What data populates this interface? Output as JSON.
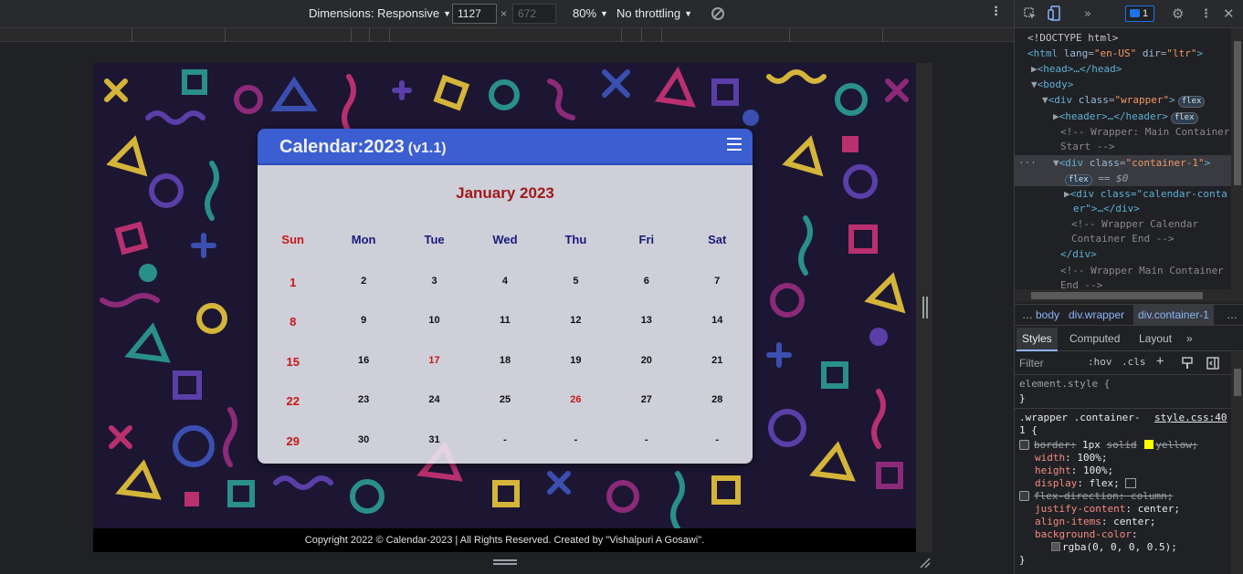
{
  "device_toolbar": {
    "dimensions_label": "Dimensions: Responsive",
    "width_value": "1127",
    "height_placeholder": "672",
    "times": "×",
    "zoom": "80%",
    "throttling": "No throttling"
  },
  "calendar": {
    "app_title": "Calendar:2023",
    "version": "(v1.1)",
    "month": "January 2023",
    "weekdays": [
      "Sun",
      "Mon",
      "Tue",
      "Wed",
      "Thu",
      "Fri",
      "Sat"
    ],
    "weeks": [
      [
        "1",
        "2",
        "3",
        "4",
        "5",
        "6",
        "7"
      ],
      [
        "8",
        "9",
        "10",
        "11",
        "12",
        "13",
        "14"
      ],
      [
        "15",
        "16",
        "17",
        "18",
        "19",
        "20",
        "21"
      ],
      [
        "22",
        "23",
        "24",
        "25",
        "26",
        "27",
        "28"
      ],
      [
        "29",
        "30",
        "31",
        "-",
        "-",
        "-",
        "-"
      ]
    ],
    "highlight_color": "#c81818"
  },
  "site_footer": {
    "text": "Copyright 2022 © Calendar-2023 | All Rights Reserved. Created by \"Vishalpuri A Gosawi\"."
  },
  "devtools": {
    "issues_count": "1",
    "tree": {
      "doctype": "<!DOCTYPE html>",
      "html_open": "<html",
      "html_lang_attr": "lang",
      "html_lang_val": "\"en-US\"",
      "html_dir_attr": "dir",
      "html_dir_val": "\"ltr\"",
      "head": "<head>…</head>",
      "body": "<body>",
      "wrapper_tag": "<div",
      "wrapper_class_attr": "class",
      "wrapper_class_val": "\"wrapper\"",
      "flex_badge": "flex",
      "header": "<header>…</header>",
      "comment_main_start_1": "<!-- Wrapper: Main Container",
      "comment_main_start_2": "Start -->",
      "container_tag": "<div",
      "container_class_val": "\"container-1\"",
      "dollar_zero": "== $0",
      "calendar_div_1": "<div class=\"calendar-conta",
      "calendar_div_2": "er\">…</div>",
      "comment_cal_end_1": "<!-- Wrapper Calendar",
      "comment_cal_end_2": "Container End -->",
      "div_close": "</div>",
      "comment_main_end_1": "<!-- Wrapper Main Container",
      "comment_main_end_2": "End -->"
    },
    "breadcrumbs": [
      "…",
      "body",
      "div.wrapper",
      "div.container-1",
      "…"
    ],
    "tabs": [
      "Styles",
      "Computed",
      "Layout",
      "»"
    ],
    "filter_placeholder": "Filter",
    "hov": ":hov",
    "cls": ".cls",
    "styles": {
      "element_style": "element.style {",
      "close_brace": "}",
      "selector_1": ".wrapper .container-",
      "selector_2": "1 {",
      "source": "style.css:40",
      "border_name": "border",
      "border_val_a": "1px",
      "border_val_b": "solid",
      "border_val_c": "yellow;",
      "width_name": "width",
      "width_val": "100%;",
      "height_name": "height",
      "height_val": "100%;",
      "display_name": "display",
      "display_val": "flex;",
      "flexdir_name": "flex-direction",
      "flexdir_val": "column;",
      "justify_name": "justify-content",
      "justify_val": "center;",
      "align_name": "align-items",
      "align_val": "center;",
      "bg_name": "background-color",
      "bg_val": "rgba(0, 0, 0, 0.5);"
    }
  }
}
